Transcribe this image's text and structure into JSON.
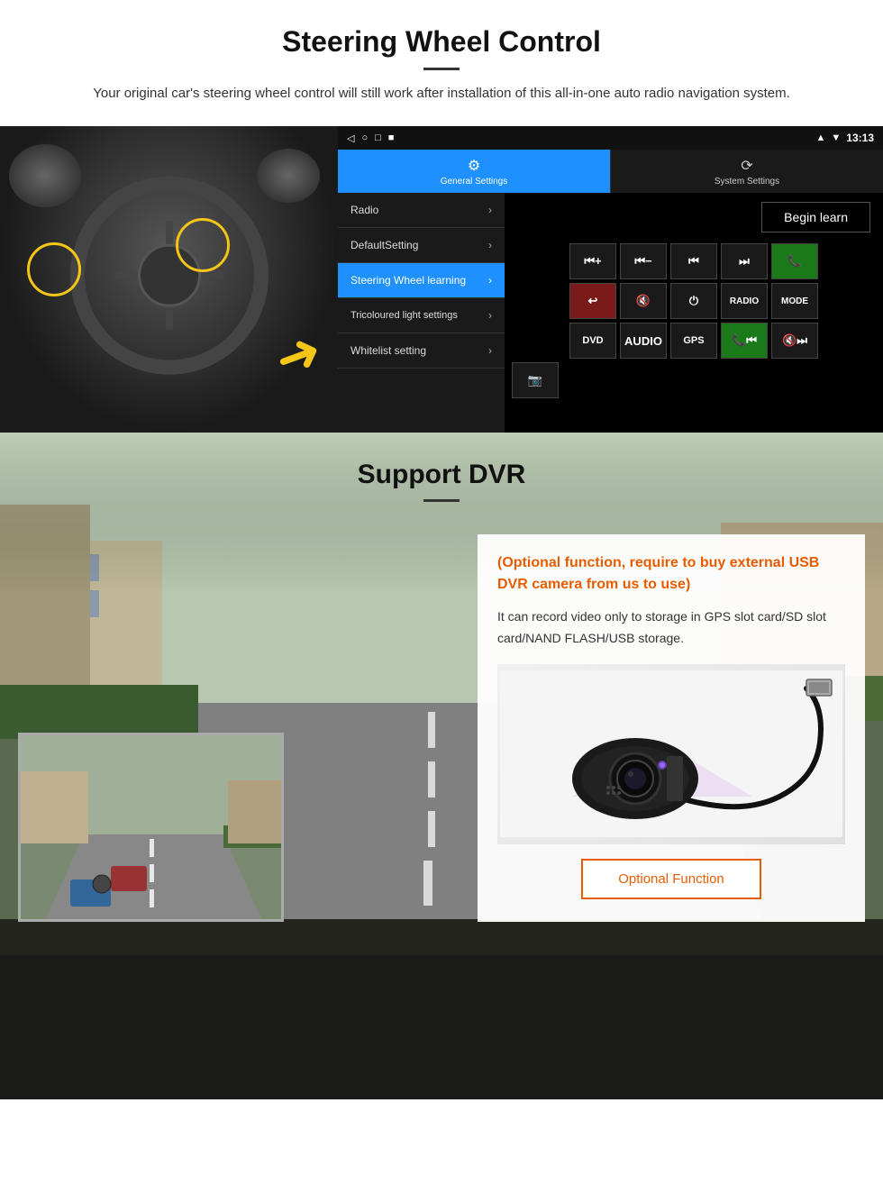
{
  "page": {
    "section1": {
      "title": "Steering Wheel Control",
      "description": "Your original car's steering wheel control will still work after installation of this all-in-one auto radio navigation system."
    },
    "android_ui": {
      "status_bar": {
        "time": "13:13",
        "icons": "◁  ○  □  ■"
      },
      "tabs": [
        {
          "label": "General Settings",
          "icon": "⚙",
          "active": true
        },
        {
          "label": "System Settings",
          "icon": "🔄",
          "active": false
        }
      ],
      "menu_items": [
        {
          "label": "Radio",
          "active": false
        },
        {
          "label": "DefaultSetting",
          "active": false
        },
        {
          "label": "Steering Wheel learning",
          "active": true
        },
        {
          "label": "Tricoloured light settings",
          "active": false
        },
        {
          "label": "Whitelist setting",
          "active": false
        }
      ],
      "begin_learn": "Begin learn",
      "control_buttons": {
        "row1": [
          "⏮+",
          "⏮−",
          "⏮⏮",
          "⏭⏭",
          "📞"
        ],
        "row2": [
          "↩",
          "🔇",
          "⏻",
          "RADIO",
          "MODE"
        ],
        "row3": [
          "DVD",
          "AUDIO",
          "GPS",
          "📞⏮",
          "🔇⏭"
        ],
        "row4": [
          "📷"
        ]
      }
    },
    "section2": {
      "title": "Support DVR",
      "optional_title": "(Optional function, require to buy external USB DVR camera from us to use)",
      "description": "It can record video only to storage in GPS slot card/SD slot card/NAND FLASH/USB storage.",
      "optional_function_btn": "Optional Function"
    }
  }
}
